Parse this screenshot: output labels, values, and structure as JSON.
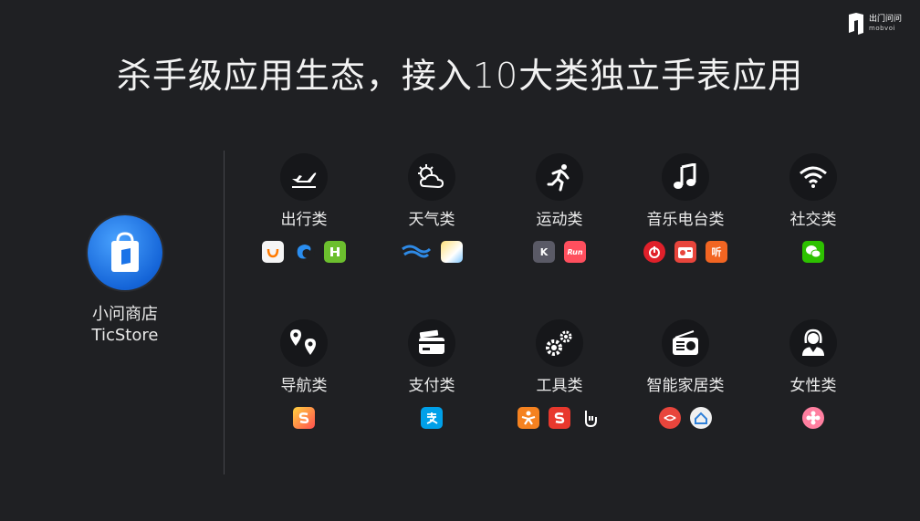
{
  "logo": {
    "text_cn": "出门问问",
    "text_en": "mobvoi"
  },
  "title": "杀手级应用生态，接入10大类独立手表应用",
  "store": {
    "name_cn": "小问商店",
    "name_en": "TicStore"
  },
  "categories": [
    {
      "label": "出行类",
      "icon": "airplane-icon",
      "apps": [
        "didi-app-icon",
        "ctrip-app-icon",
        "mobike-app-icon"
      ]
    },
    {
      "label": "天气类",
      "icon": "weather-icon",
      "apps": [
        "moji-weather-app-icon",
        "weather-app-icon"
      ]
    },
    {
      "label": "运动类",
      "icon": "running-icon",
      "apps": [
        "keep-app-icon",
        "run-app-icon"
      ]
    },
    {
      "label": "音乐电台类",
      "icon": "music-note-icon",
      "apps": [
        "netease-music-app-icon",
        "radio-app-icon",
        "ting-app-icon"
      ]
    },
    {
      "label": "社交类",
      "icon": "wifi-icon",
      "apps": [
        "wechat-app-icon"
      ]
    },
    {
      "label": "导航类",
      "icon": "map-pins-icon",
      "apps": [
        "sogou-map-app-icon"
      ]
    },
    {
      "label": "支付类",
      "icon": "wallet-icon",
      "apps": [
        "alipay-app-icon"
      ]
    },
    {
      "label": "工具类",
      "icon": "gears-icon",
      "apps": [
        "tool-app-icon-1",
        "sogou-app-icon",
        "touch-app-icon"
      ]
    },
    {
      "label": "智能家居类",
      "icon": "radio-device-icon",
      "apps": [
        "smart-home-app-icon-1",
        "smart-home-app-icon-2"
      ]
    },
    {
      "label": "女性类",
      "icon": "woman-icon",
      "apps": [
        "female-app-icon"
      ]
    }
  ],
  "app_glyphs": {
    "ting": "听",
    "keep": "K",
    "run": "Run"
  },
  "colors": {
    "background": "#1f2023",
    "store_blue": "#1a73e8"
  }
}
